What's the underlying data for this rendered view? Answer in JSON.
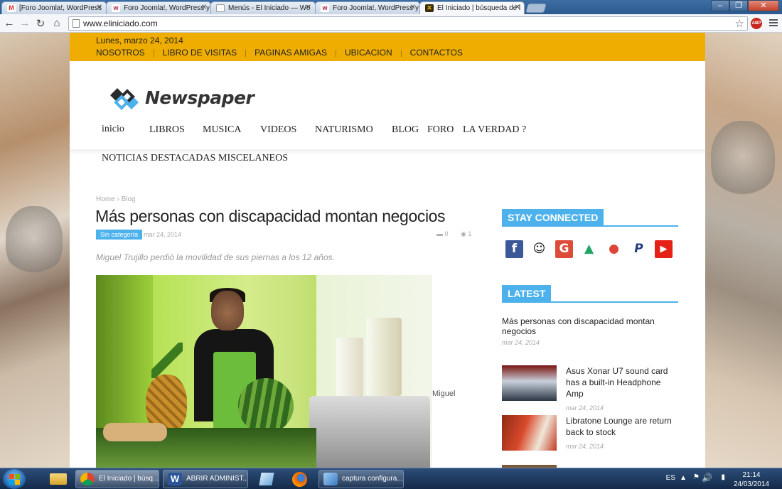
{
  "browser": {
    "tabs": [
      {
        "label": "[Foro Joomla!, WordPress",
        "favicon": "gmail-icon",
        "active": false
      },
      {
        "label": "Foro Joomla!, WordPress y",
        "favicon": "forum-icon",
        "active": false
      },
      {
        "label": "Menús - El Iniciado — Wo",
        "favicon": "page-icon",
        "active": false
      },
      {
        "label": "Foro Joomla!, WordPress y",
        "favicon": "forum-icon",
        "active": false
      },
      {
        "label": "El Iniciado | búsqueda de l",
        "favicon": "site-icon",
        "active": true
      }
    ],
    "url": "www.eliniciado.com",
    "abp_label": "ABP"
  },
  "site": {
    "date": "Lunes, marzo 24, 2014",
    "top_links": [
      "NOSOTROS",
      "LIBRO DE VISITAS",
      "PAGINAS AMIGAS",
      "UBICACION",
      "CONTACTOS"
    ],
    "logo_text": "Newspaper",
    "nav": [
      "inicio",
      "LIBROS",
      "MUSICA",
      "VIDEOS",
      "NATURISMO",
      "BLOG",
      "FORO",
      "LA VERDAD ?",
      "NOTICIAS DESTACADAS",
      "MISCELANEOS"
    ],
    "colors": {
      "topbar": "#eead00",
      "accent": "#4db2ec"
    }
  },
  "article": {
    "breadcrumb": {
      "home": "Home",
      "sep": "›",
      "section": "Blog"
    },
    "title": "Más personas con discapacidad montan negocios",
    "category": "Sin categoría",
    "date": "mar 24, 2014",
    "comments": "0",
    "views": "1",
    "excerpt": "Miguel Trujillo perdió la movilidad de sus piernas a los 12 años.",
    "caption": "Miguel"
  },
  "sidebar": {
    "stay_connected": "STAY CONNECTED",
    "social": [
      {
        "icon": "facebook-icon",
        "glyph": "f",
        "color": "#3b5998"
      },
      {
        "icon": "github-icon",
        "glyph": "☺",
        "color": "#ffffff"
      },
      {
        "icon": "googleplus-icon",
        "glyph": "G",
        "color": "#dd4b39"
      },
      {
        "icon": "drive-icon",
        "glyph": "▲",
        "color": "#ffffff"
      },
      {
        "icon": "maps-pin-icon",
        "glyph": "●",
        "color": "#ffffff"
      },
      {
        "icon": "paypal-icon",
        "glyph": "P",
        "color": "#ffffff"
      },
      {
        "icon": "youtube-icon",
        "glyph": "▶",
        "color": "#e62117"
      }
    ],
    "latest_label": "LATEST",
    "latest_first": {
      "title": "Más personas con discapacidad montan negocios",
      "date": "mar 24, 2014"
    },
    "latest_items": [
      {
        "title": "Asus Xonar U7 sound card has a built-in Headphone Amp",
        "date": "mar 24, 2014"
      },
      {
        "title": "Libratone Lounge are return back to stock",
        "date": "mar 24, 2014"
      }
    ]
  },
  "taskbar": {
    "items": [
      {
        "label": "El Iniciado | búsq...",
        "icon": "chrome-icon"
      },
      {
        "label": "ABRIR ADMINIST...",
        "icon": "word-icon"
      },
      {
        "label": "captura configura...",
        "icon": "paint-icon"
      }
    ],
    "language": "ES",
    "time": "21:14",
    "date": "24/03/2014"
  }
}
